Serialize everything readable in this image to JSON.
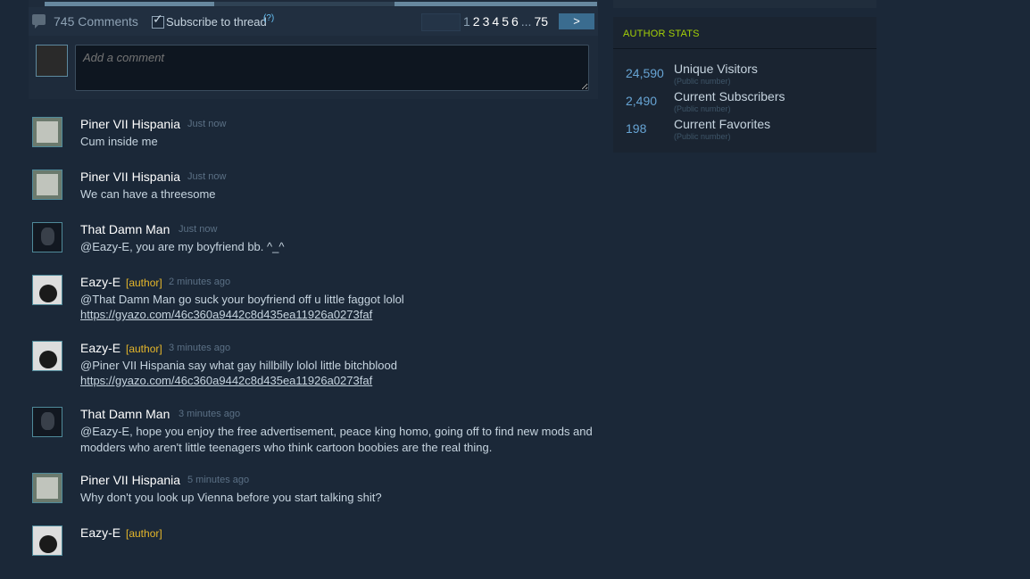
{
  "comments_header": {
    "count": "745 Comments",
    "subscribe_label": "Subscribe to thread",
    "subscribe_help": "(?)",
    "pages": [
      "1",
      "2",
      "3",
      "4",
      "5",
      "6",
      "...",
      "75"
    ],
    "next_label": ">"
  },
  "comment_input": {
    "placeholder": "Add a comment"
  },
  "comments": [
    {
      "author": "Piner VII Hispania",
      "tag": "",
      "time": "Just now",
      "text": "Cum inside me",
      "link": ""
    },
    {
      "author": "Piner VII Hispania",
      "tag": "",
      "time": "Just now",
      "text": "We can have a threesome",
      "link": ""
    },
    {
      "author": "That Damn Man",
      "tag": "",
      "time": "Just now",
      "text": "@Eazy-E, you are my boyfriend bb. ^_^",
      "link": ""
    },
    {
      "author": "Eazy-E",
      "tag": "[author]",
      "time": "2 minutes ago",
      "text": "@That Damn Man go suck your boyfriend off u little faggot lolol",
      "link": "https://gyazo.com/46c360a9442c8d435ea11926a0273faf"
    },
    {
      "author": "Eazy-E",
      "tag": "[author]",
      "time": "3 minutes ago",
      "text": "@Piner VII Hispania say what gay hillbilly lolol little bitchblood",
      "link": "https://gyazo.com/46c360a9442c8d435ea11926a0273faf"
    },
    {
      "author": "That Damn Man",
      "tag": "",
      "time": "3 minutes ago",
      "text": "@Eazy-E, hope you enjoy the free advertisement, peace king homo, going off to find new mods and\nmodders who aren't little teenagers who think cartoon boobies are the real thing.",
      "link": ""
    },
    {
      "author": "Piner VII Hispania",
      "tag": "",
      "time": "5 minutes ago",
      "text": "Why don't you look up Vienna before you start talking shit?",
      "link": ""
    },
    {
      "author": "Eazy-E",
      "tag": "[author]",
      "time": "",
      "text": "",
      "link": ""
    }
  ],
  "author_stats": {
    "title": "AUTHOR STATS",
    "items": [
      {
        "value": "24,590",
        "label": "Unique Visitors",
        "sub": "(Public number)"
      },
      {
        "value": "2,490",
        "label": "Current Subscribers",
        "sub": "(Public number)"
      },
      {
        "value": "198",
        "label": "Current Favorites",
        "sub": "(Public number)"
      }
    ]
  },
  "colors": {
    "background": "#1b2838",
    "author_tag": "#e5b62a",
    "stats_title": "#a4d007",
    "stat_value": "#67a4d4"
  }
}
